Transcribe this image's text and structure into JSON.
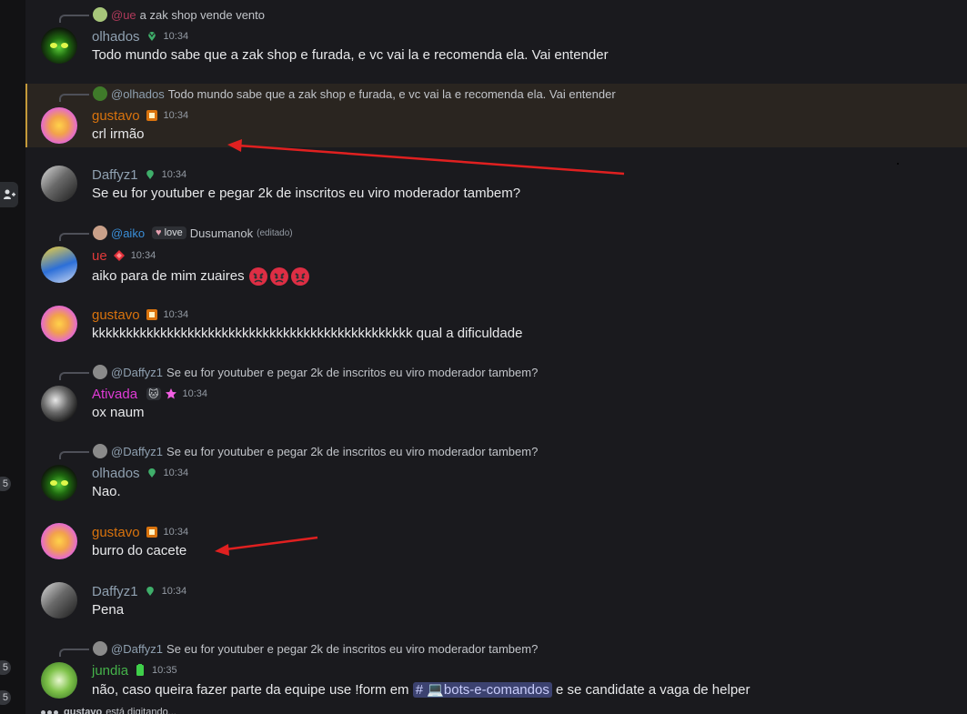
{
  "colors": {
    "olhados": "#8fa0b0",
    "gustavo": "#d9730d",
    "daffyz": "#8fa0b0",
    "ue": "#e03a3a",
    "ativada": "#e03bd6",
    "jundia": "#45b24a",
    "mention_ue": "#b03a5b",
    "mention_aiko": "#3a8fd9",
    "annotation_arrow": "#e02020"
  },
  "messages": [
    {
      "reply": {
        "mention": "@ue",
        "text": "a zak shop vende vento"
      },
      "author": "olhados",
      "time": "10:34",
      "text": "Todo mundo sabe que a zak shop e furada, e vc vai la e recomenda ela. Vai entender"
    },
    {
      "reply": {
        "mention": "@olhados",
        "text": "Todo mundo sabe que a zak shop e furada, e vc vai la e recomenda ela. Vai entender"
      },
      "author": "gustavo",
      "time": "10:34",
      "text": "crl irmão"
    },
    {
      "author": "Daffyz1",
      "time": "10:34",
      "text": "Se eu for youtuber e pegar 2k de inscritos eu viro moderador tambem?"
    },
    {
      "reply": {
        "mention": "@aiko",
        "role": "love",
        "text": "Dusumanok",
        "edited": "(editado)"
      },
      "author": "ue",
      "time": "10:34",
      "text": "aiko para de mim zuaires"
    },
    {
      "author": "gustavo",
      "time": "10:34",
      "text": "kkkkkkkkkkkkkkkkkkkkkkkkkkkkkkkkkkkkkkkkkkkkkkk qual a dificuldade"
    },
    {
      "reply": {
        "mention": "@Daffyz1",
        "text": "Se eu for youtuber e pegar 2k de inscritos eu viro moderador tambem?"
      },
      "author": "Ativada",
      "time": "10:34",
      "text": "ox naum"
    },
    {
      "reply": {
        "mention": "@Daffyz1",
        "text": "Se eu for youtuber e pegar 2k de inscritos eu viro moderador tambem?"
      },
      "author": "olhados",
      "time": "10:34",
      "text": "Nao."
    },
    {
      "author": "gustavo",
      "time": "10:34",
      "text": "burro do cacete"
    },
    {
      "author": "Daffyz1",
      "time": "10:34",
      "text": "Pena"
    },
    {
      "reply": {
        "mention": "@Daffyz1",
        "text": "Se eu for youtuber e pegar 2k de inscritos eu viro moderador tambem?"
      },
      "author": "jundia",
      "time": "10:35",
      "text_before": "não, caso queira fazer parte da equipe use !form em",
      "channel": "bots-e-comandos",
      "text_after": "e se candidate a vaga de helper"
    }
  ],
  "typing": {
    "user": "gustavo",
    "text": "está digitando..."
  },
  "sidebar_badges": [
    "5",
    "5",
    "5"
  ],
  "icons": {
    "server": "add-server-icon",
    "crown": "leaf-badge-icon",
    "angry": "angry-face-emoji",
    "laptop": "laptop-emoji",
    "hash": "#"
  }
}
